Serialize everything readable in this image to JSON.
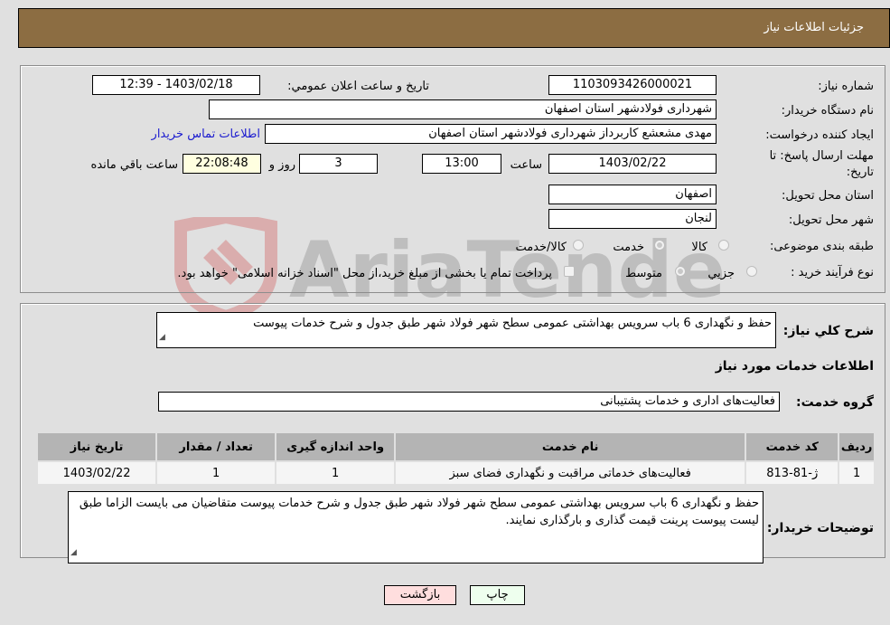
{
  "header": {
    "title": "جزئیات اطلاعات نیاز"
  },
  "form": {
    "need_number_label": "شماره نیاز:",
    "need_number": "1103093426000021",
    "announce_label": "تاریخ و ساعت اعلان عمومي:",
    "announce_value": "1403/02/18 - 12:39",
    "buyer_org_label": "نام دستگاه خریدار:",
    "buyer_org": "شهرداری فولادشهر استان اصفهان",
    "creator_label": "ایجاد کننده درخواست:",
    "creator": "مهدی مشعشع کاربرداز شهرداری فولادشهر استان اصفهان",
    "contact_link": "اطلاعات تماس خریدار",
    "deadline_label_1": "مهلت ارسال پاسخ: تا",
    "deadline_label_2": "تاریخ:",
    "deadline_date": "1403/02/22",
    "time_label": "ساعت",
    "deadline_time": "13:00",
    "days_value": "3",
    "days_label": "روز و",
    "remaining_time": "22:08:48",
    "remaining_label": "ساعت باقي مانده",
    "province_label": "استان محل تحویل:",
    "province": "اصفهان",
    "city_label": "شهر محل تحویل:",
    "city": "لنجان",
    "category_label": "طبقه بندی موضوعی:",
    "category_options": [
      {
        "label": "کالا",
        "selected": false
      },
      {
        "label": "خدمت",
        "selected": true
      },
      {
        "label": "کالا/خدمت",
        "selected": false
      }
    ],
    "purchase_type_label": "نوع فرآیند خرید :",
    "purchase_options": [
      {
        "label": "جزیي",
        "selected": false
      },
      {
        "label": "متوسط",
        "selected": true
      }
    ],
    "treasury_note": "پرداخت تمام یا بخشی از مبلغ خرید،از محل \"اسناد خزانه اسلامی\" خواهد بود.",
    "treasury_checked": false
  },
  "details": {
    "summary_label": "شرح كلي نياز:",
    "summary": "حفظ  و نگهداری 6 باب سرویس بهداشتی عمومی سطح  شهر فولاد شهر طبق جدول و شرح خدمات پیوست",
    "services_heading": "اطلاعات خدمات مورد نياز",
    "service_group_label": "گروه خدمت:",
    "service_group": "فعالیت‌های اداری و خدمات پشتیبانی",
    "table": {
      "headers": [
        "ردیف",
        "کد خدمت",
        "نام خدمت",
        "واحد اندازه گیری",
        "تعداد / مقدار",
        "تاریخ نیاز"
      ],
      "rows": [
        [
          "1",
          "ژ-81-813",
          "فعالیت‌های خدماتی مراقبت و نگهداری فضای سبز",
          "1",
          "1",
          "1403/02/22"
        ]
      ]
    },
    "buyer_notes_label": "توضیحات خریدار:",
    "buyer_notes": "حفظ  و نگهداری 6 باب سرویس بهداشتی عمومی سطح  شهر فولاد شهر طبق جدول و شرح خدمات پیوست متقاضیان می بایست الزاما طبق لیست پیوست پرینت قیمت گذاری و بارگذاری نمایند."
  },
  "buttons": {
    "print": "چاپ",
    "back": "بازگشت"
  },
  "colors": {
    "header_bg": "#8c6d42",
    "print_bg": "#eeffee",
    "back_bg": "#ffdede",
    "link": "#1c1ccf"
  },
  "watermark": "AriaTender.neT"
}
